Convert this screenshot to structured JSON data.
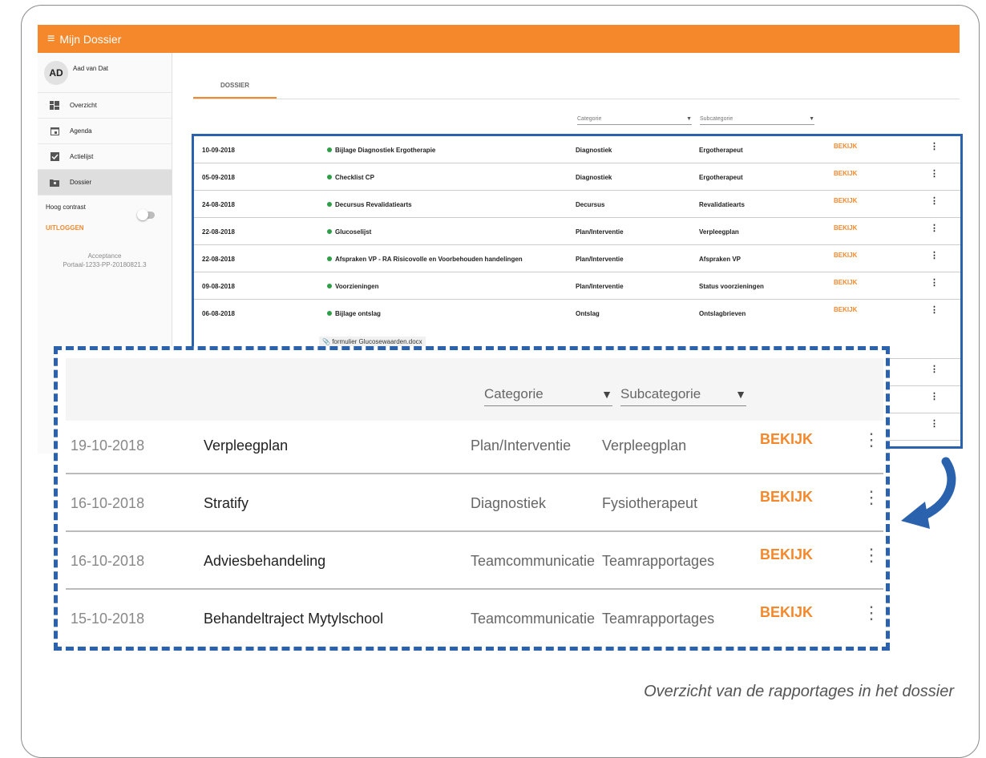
{
  "app": {
    "menu_icon": "hamburger-icon",
    "title": "Mijn Dossier"
  },
  "user": {
    "initials": "AD",
    "name": "Aad van Dat"
  },
  "nav": [
    {
      "label": "Overzicht",
      "icon": "dashboard-icon",
      "active": false
    },
    {
      "label": "Agenda",
      "icon": "calendar-icon",
      "active": false
    },
    {
      "label": "Actielijst",
      "icon": "checkbox-icon",
      "active": false
    },
    {
      "label": "Dossier",
      "icon": "folder-icon",
      "active": true
    }
  ],
  "high_contrast": {
    "label": "Hoog contrast",
    "on": false
  },
  "logout_label": "UITLOGGEN",
  "version": {
    "line1": "Acceptance",
    "line2": "Portaal-1233-PP-20180821.3"
  },
  "tab_label": "DOSSIER",
  "filters": {
    "category": "Categorie",
    "subcategory": "Subcategorie"
  },
  "table_rows": [
    {
      "date": "10-09-2018",
      "title": "Bijlage Diagnostiek Ergotherapie",
      "category": "Diagnostiek",
      "subcategory": "Ergotherapeut",
      "action": "BEKIJK"
    },
    {
      "date": "05-09-2018",
      "title": "Checklist CP",
      "category": "Diagnostiek",
      "subcategory": "Ergotherapeut",
      "action": "BEKIJK"
    },
    {
      "date": "24-08-2018",
      "title": "Decursus Revalidatiearts",
      "category": "Decursus",
      "subcategory": "Revalidatiearts",
      "action": "BEKIJK"
    },
    {
      "date": "22-08-2018",
      "title": "Glucoselijst",
      "category": "Plan/Interventie",
      "subcategory": "Verpleegplan",
      "action": "BEKIJK"
    },
    {
      "date": "22-08-2018",
      "title": "Afspraken VP - RA Risicovolle en Voorbehouden handelingen",
      "category": "Plan/Interventie",
      "subcategory": "Afspraken VP",
      "action": "BEKIJK"
    },
    {
      "date": "09-08-2018",
      "title": "Voorzieningen",
      "category": "Plan/Interventie",
      "subcategory": "Status voorzieningen",
      "action": "BEKIJK"
    },
    {
      "date": "06-08-2018",
      "title": "Bijlage ontslag",
      "category": "Ontslag",
      "subcategory": "Ontslagbrieven",
      "action": "BEKIJK"
    }
  ],
  "attachment": "formulier Glucosewaarden.docx",
  "zoom_rows": [
    {
      "date": "19-10-2018",
      "title": "Verpleegplan",
      "category": "Plan/Interventie",
      "subcategory": "Verpleegplan",
      "action": "BEKIJK"
    },
    {
      "date": "16-10-2018",
      "title": "Stratify",
      "category": "Diagnostiek",
      "subcategory": "Fysiotherapeut",
      "action": "BEKIJK"
    },
    {
      "date": "16-10-2018",
      "title": "Adviesbehandeling",
      "category": "Teamcommunicatie",
      "subcategory": "Teamrapportages",
      "action": "BEKIJK"
    },
    {
      "date": "15-10-2018",
      "title": "Behandeltraject Mytylschool",
      "category": "Teamcommunicatie",
      "subcategory": "Teamrapportages",
      "action": "BEKIJK"
    }
  ],
  "caption": "Overzicht van de rapportages in het dossier",
  "colors": {
    "accent": "#f5882b",
    "highlight": "#2b62ad",
    "status_dot": "#2e9e47"
  }
}
